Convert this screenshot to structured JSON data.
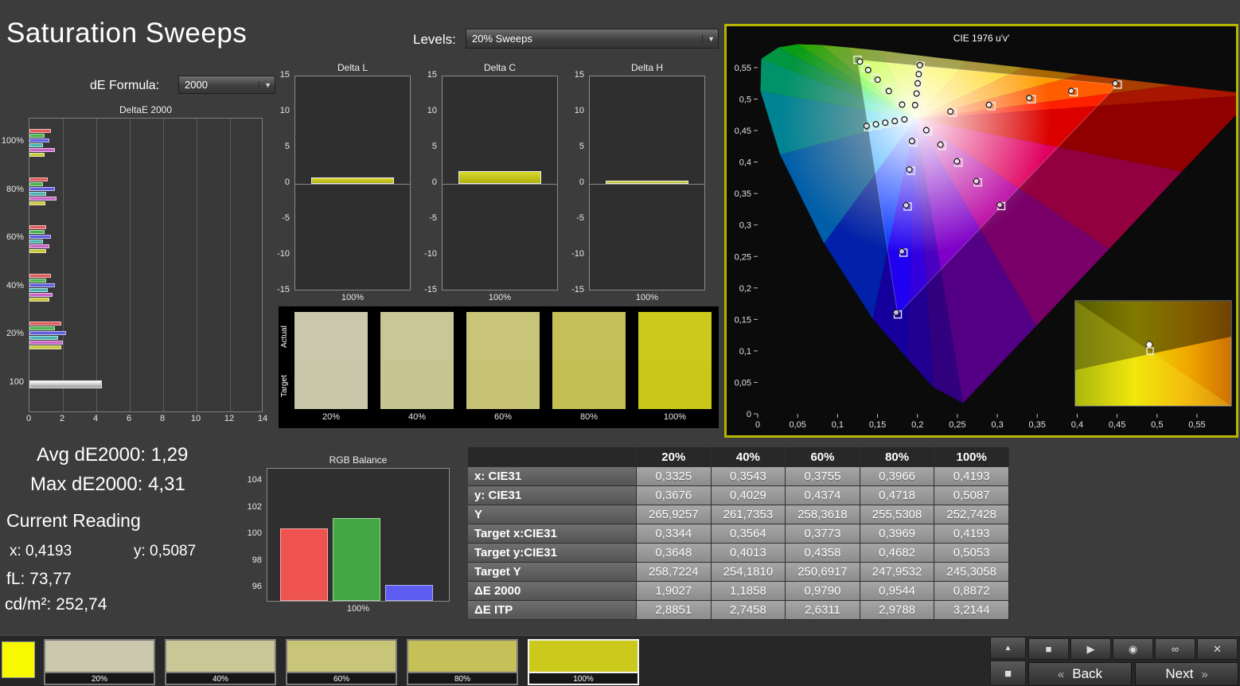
{
  "window": {
    "title": "Saturation Sweeps"
  },
  "header": {
    "levels_label": "Levels:",
    "levels_value": "20% Sweeps",
    "de_formula_label": "dE Formula:",
    "de_formula_value": "2000"
  },
  "readings": {
    "avg": "Avg dE2000: 1,29",
    "max": "Max dE2000: 4,31",
    "current_title": "Current Reading",
    "x": "x: 0,4193",
    "y": "y: 0,5087",
    "fl": "fL: 73,77",
    "cd": "cd/m²: 252,74"
  },
  "swatch_panel": {
    "row_labels": [
      "Actual",
      "Target"
    ],
    "items": [
      {
        "label": "20%",
        "actual": "#cac9ad",
        "target": "#c8c7a9"
      },
      {
        "label": "40%",
        "actual": "#c9c795",
        "target": "#c7c591"
      },
      {
        "label": "60%",
        "actual": "#c8c478",
        "target": "#c6c274"
      },
      {
        "label": "80%",
        "actual": "#c5c158",
        "target": "#c3bf54"
      },
      {
        "label": "100%",
        "actual": "#cbca1c",
        "target": "#c9c818"
      }
    ]
  },
  "bottom_bar": {
    "current_patch_color": "#f8f800",
    "swatches": [
      {
        "label": "20%",
        "color": "#cac9ad",
        "selected": false
      },
      {
        "label": "40%",
        "color": "#c9c795",
        "selected": false
      },
      {
        "label": "60%",
        "color": "#c8c478",
        "selected": false
      },
      {
        "label": "80%",
        "color": "#c5c158",
        "selected": false
      },
      {
        "label": "100%",
        "color": "#cbca1c",
        "selected": true
      }
    ],
    "transport": [
      {
        "name": "stop",
        "glyph": "■"
      },
      {
        "name": "play",
        "glyph": "▶"
      },
      {
        "name": "record",
        "glyph": "◉"
      },
      {
        "name": "loop",
        "glyph": "∞"
      },
      {
        "name": "close",
        "glyph": "✕"
      }
    ],
    "pager_up_glyph": "▲",
    "pager_stop_glyph": "■",
    "back_label": "Back",
    "back_chevrons": "«",
    "next_label": "Next",
    "next_chevrons": "»"
  },
  "chart_data": [
    {
      "id": "deltae2000",
      "type": "bar",
      "orientation": "horizontal",
      "title": "DeltaE 2000",
      "xlim": [
        0,
        14
      ],
      "xtick_labels": [
        "0",
        "2",
        "4",
        "6",
        "8",
        "10",
        "12",
        "14"
      ],
      "colors": [
        "#e05a5a",
        "#4ab44a",
        "#5f5fe0",
        "#4ab4b4",
        "#c864c8",
        "#c8c83c"
      ],
      "series_names": [
        "red",
        "green",
        "blue",
        "cyan",
        "magenta",
        "yellow"
      ],
      "groups": [
        {
          "label": "100%",
          "values": [
            1.3,
            0.9,
            1.2,
            0.8,
            1.5,
            0.89
          ]
        },
        {
          "label": "80%",
          "values": [
            1.1,
            0.8,
            1.5,
            1.0,
            1.6,
            0.95
          ]
        },
        {
          "label": "60%",
          "values": [
            1.0,
            0.9,
            1.3,
            0.8,
            1.2,
            0.98
          ]
        },
        {
          "label": "40%",
          "values": [
            1.3,
            1.0,
            1.5,
            1.1,
            1.4,
            1.19
          ]
        },
        {
          "label": "20%",
          "values": [
            1.9,
            1.5,
            2.2,
            1.7,
            2.0,
            1.9
          ]
        },
        {
          "label": "100",
          "values": [
            4.31
          ],
          "style": "white"
        }
      ]
    },
    {
      "id": "delta_l",
      "type": "bar",
      "title": "Delta L",
      "ylim": [
        -15,
        15
      ],
      "ytick_labels": [
        "15",
        "10",
        "5",
        "0",
        "-5",
        "-10",
        "-15"
      ],
      "categories": [
        "100%"
      ],
      "values": [
        0.9
      ],
      "bar_color": "#c9c925"
    },
    {
      "id": "delta_c",
      "type": "bar",
      "title": "Delta C",
      "ylim": [
        -15,
        15
      ],
      "ytick_labels": [
        "15",
        "10",
        "5",
        "0",
        "-5",
        "-10",
        "-15"
      ],
      "categories": [
        "100%"
      ],
      "values": [
        1.8
      ],
      "bar_color": "#c9c925"
    },
    {
      "id": "delta_h",
      "type": "bar",
      "title": "Delta H",
      "ylim": [
        -15,
        15
      ],
      "ytick_labels": [
        "15",
        "10",
        "5",
        "0",
        "-5",
        "-10",
        "-15"
      ],
      "categories": [
        "100%"
      ],
      "values": [
        0.4
      ],
      "bar_color": "#c9c925"
    },
    {
      "id": "rgb_balance",
      "type": "bar",
      "title": "RGB Balance",
      "ylim": [
        95,
        105
      ],
      "yticks": [
        104,
        102,
        100,
        98,
        96
      ],
      "ytick_labels": [
        "104",
        "102",
        "100",
        "98",
        "96"
      ],
      "xlabel": "100%",
      "series": [
        {
          "name": "red",
          "color": "#ef5350",
          "value": 100.4
        },
        {
          "name": "green",
          "color": "#43a843",
          "value": 101.2
        },
        {
          "name": "blue",
          "color": "#5c5cf0",
          "value": 96.2
        }
      ]
    },
    {
      "id": "cie_1976",
      "type": "scatter",
      "title": "CIE 1976 u'v'",
      "xlim": [
        0,
        0.6
      ],
      "ylim": [
        0,
        0.6
      ],
      "xtick_labels": [
        "0",
        "0,05",
        "0,1",
        "0,15",
        "0,2",
        "0,25",
        "0,3",
        "0,35",
        "0,4",
        "0,45",
        "0,5",
        "0,55"
      ],
      "ytick_labels": [
        "0",
        "0,05",
        "0,1",
        "0,15",
        "0,2",
        "0,25",
        "0,3",
        "0,35",
        "0,4",
        "0,45",
        "0,5",
        "0,55"
      ],
      "white_point": [
        0.1978,
        0.4683
      ],
      "gamut_triangle": [
        [
          0.4507,
          0.5229
        ],
        [
          0.125,
          0.5625
        ],
        [
          0.1754,
          0.1579
        ]
      ],
      "spectral_locus": [
        [
          0.257,
          0.017,
          "#4a00c0"
        ],
        [
          0.22,
          0.042,
          "#3300dd"
        ],
        [
          0.188,
          0.087,
          "#2000f0"
        ],
        [
          0.144,
          0.151,
          "#0033ff"
        ],
        [
          0.083,
          0.271,
          "#0090ff"
        ],
        [
          0.028,
          0.412,
          "#00c8e0"
        ],
        [
          0.0035,
          0.513,
          "#00e0a0"
        ],
        [
          0.0046,
          0.564,
          "#00e460"
        ],
        [
          0.026,
          0.582,
          "#10f020"
        ],
        [
          0.05,
          0.587,
          "#40fa00"
        ],
        [
          0.079,
          0.586,
          "#80ff00"
        ],
        [
          0.113,
          0.582,
          "#b4ff00"
        ],
        [
          0.153,
          0.577,
          "#dcf800"
        ],
        [
          0.203,
          0.569,
          "#f8ee00"
        ],
        [
          0.262,
          0.56,
          "#ffd000"
        ],
        [
          0.332,
          0.55,
          "#ff9c00"
        ],
        [
          0.404,
          0.539,
          "#ff5e00"
        ],
        [
          0.52,
          0.522,
          "#ff2000"
        ],
        [
          0.623,
          0.507,
          "#dc0000"
        ],
        [
          0.531,
          0.385,
          "#e00060"
        ],
        [
          0.44,
          0.262,
          "#b800a0"
        ],
        [
          0.349,
          0.14,
          "#7f00c8"
        ]
      ],
      "targets": [
        [
          0.2443,
          0.4783
        ],
        [
          0.2926,
          0.4888
        ],
        [
          0.343,
          0.4997
        ],
        [
          0.3956,
          0.511
        ],
        [
          0.4507,
          0.5229
        ],
        [
          0.1778,
          0.4942
        ],
        [
          0.1612,
          0.5157
        ],
        [
          0.1472,
          0.5338
        ],
        [
          0.1353,
          0.5492
        ],
        [
          0.125,
          0.5625
        ],
        [
          0.1952,
          0.4313
        ],
        [
          0.1919,
          0.3861
        ],
        [
          0.1878,
          0.3293
        ],
        [
          0.1825,
          0.256
        ],
        [
          0.1754,
          0.1579
        ],
        [
          0.1857,
          0.4657
        ],
        [
          0.1736,
          0.4631
        ],
        [
          0.1617,
          0.4605
        ],
        [
          0.15,
          0.458
        ],
        [
          0.1383,
          0.4554
        ],
        [
          0.2131,
          0.4486
        ],
        [
          0.2308,
          0.4257
        ],
        [
          0.2514,
          0.3991
        ],
        [
          0.2757,
          0.3676
        ],
        [
          0.305,
          0.33
        ],
        [
          0.1994,
          0.4894
        ],
        [
          0.2007,
          0.5085
        ],
        [
          0.2019,
          0.5247
        ],
        [
          0.2029,
          0.5385
        ],
        [
          0.2039,
          0.5529
        ]
      ],
      "measured": [
        [
          0.2413,
          0.4803
        ],
        [
          0.2896,
          0.4908
        ],
        [
          0.34,
          0.5017
        ],
        [
          0.3926,
          0.513
        ],
        [
          0.4477,
          0.5249
        ],
        [
          0.1808,
          0.4912
        ],
        [
          0.1642,
          0.5127
        ],
        [
          0.1502,
          0.5308
        ],
        [
          0.1383,
          0.5462
        ],
        [
          0.128,
          0.5595
        ],
        [
          0.1932,
          0.4333
        ],
        [
          0.1899,
          0.3881
        ],
        [
          0.1858,
          0.3313
        ],
        [
          0.1805,
          0.258
        ],
        [
          0.1734,
          0.1609
        ],
        [
          0.1837,
          0.4677
        ],
        [
          0.1716,
          0.4651
        ],
        [
          0.1597,
          0.4625
        ],
        [
          0.148,
          0.46
        ],
        [
          0.1363,
          0.4574
        ],
        [
          0.2111,
          0.4506
        ],
        [
          0.2288,
          0.4277
        ],
        [
          0.2494,
          0.4011
        ],
        [
          0.2737,
          0.3696
        ],
        [
          0.303,
          0.332
        ],
        [
          0.1971,
          0.4904
        ],
        [
          0.1989,
          0.5088
        ],
        [
          0.2003,
          0.525
        ],
        [
          0.2016,
          0.5396
        ],
        [
          0.2029,
          0.5539
        ]
      ]
    },
    {
      "id": "results_table",
      "type": "table",
      "columns": [
        "",
        "20%",
        "40%",
        "60%",
        "80%",
        "100%"
      ],
      "rows": [
        [
          "x: CIE31",
          "0,3325",
          "0,3543",
          "0,3755",
          "0,3966",
          "0,4193"
        ],
        [
          "y: CIE31",
          "0,3676",
          "0,4029",
          "0,4374",
          "0,4718",
          "0,5087"
        ],
        [
          "Y",
          "265,9257",
          "261,7353",
          "258,3618",
          "255,5308",
          "252,7428"
        ],
        [
          "Target x:CIE31",
          "0,3344",
          "0,3564",
          "0,3773",
          "0,3969",
          "0,4193"
        ],
        [
          "Target y:CIE31",
          "0,3648",
          "0,4013",
          "0,4358",
          "0,4682",
          "0,5053"
        ],
        [
          "Target Y",
          "258,7224",
          "254,1810",
          "250,6917",
          "247,9532",
          "245,3058"
        ],
        [
          "ΔE 2000",
          "1,9027",
          "1,1858",
          "0,9790",
          "0,9544",
          "0,8872"
        ],
        [
          "ΔE ITP",
          "2,8851",
          "2,7458",
          "2,6311",
          "2,9788",
          "3,2144"
        ]
      ]
    }
  ]
}
